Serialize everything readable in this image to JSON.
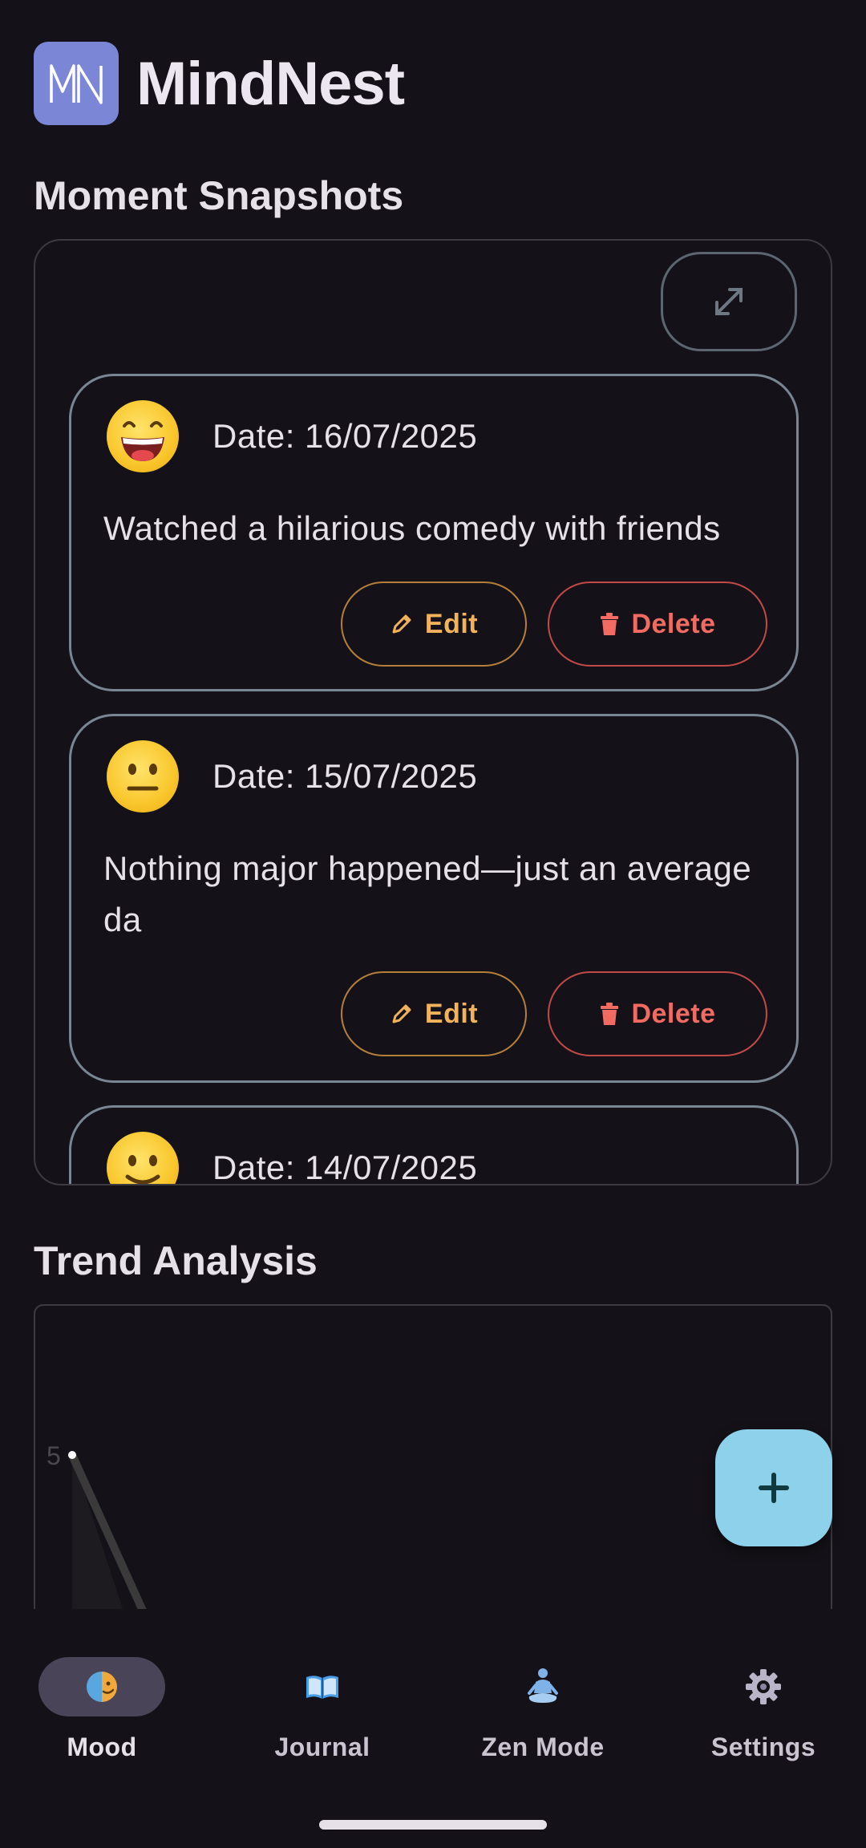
{
  "app": {
    "title": "MindNest",
    "logo_text": "MN",
    "accent": "#7B86D6"
  },
  "snapshots": {
    "section_title": "Moment Snapshots",
    "expand_icon": "expand-diagonal-icon",
    "cards": [
      {
        "emoji": "grinning-face",
        "date": "Date: 16/07/2025",
        "note": "Watched a hilarious comedy with friends",
        "edit_label": "Edit",
        "delete_label": "Delete"
      },
      {
        "emoji": "neutral-face",
        "date": "Date: 15/07/2025",
        "note": "Nothing major happened—just an average da",
        "edit_label": "Edit",
        "delete_label": "Delete"
      },
      {
        "emoji": "slight-smile-face",
        "date": "Date: 14/07/2025"
      }
    ]
  },
  "trend": {
    "section_title": "Trend Analysis",
    "y_tick_top": "5"
  },
  "fab": {
    "label": "+",
    "color": "#8DD1EA"
  },
  "bottom_nav": {
    "items": [
      {
        "label": "Mood",
        "icon": "mood-face-icon",
        "active": true
      },
      {
        "label": "Journal",
        "icon": "open-book-icon",
        "active": false
      },
      {
        "label": "Zen Mode",
        "icon": "meditation-icon",
        "active": false
      },
      {
        "label": "Settings",
        "icon": "gear-icon",
        "active": false
      }
    ]
  },
  "colors": {
    "background": "#141218",
    "edit": "#F2B25C",
    "delete": "#F26B63",
    "card_border": "#7A8593"
  }
}
